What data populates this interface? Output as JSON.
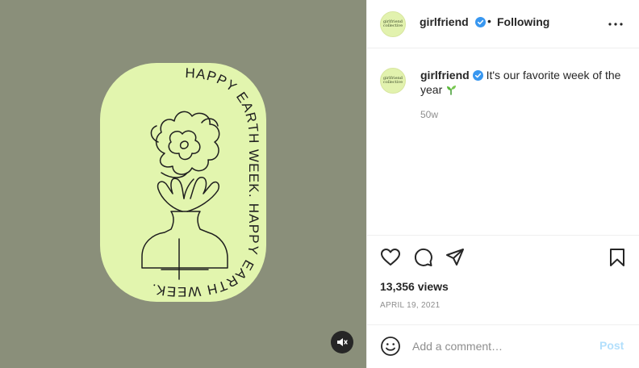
{
  "media": {
    "background": "#8a8f7a",
    "badge_color": "#e2f5ae",
    "ring_text_top": "HAPPY EARTH WEEK. HAPPY EARTH WEEK.",
    "ring_text_bottom": "HAPPY EARTH WEEK. HAPPY EARTH WEEK.",
    "mute_icon": "speaker-muted-icon"
  },
  "header": {
    "avatar_line1": "girlfriend",
    "avatar_line2": "collective",
    "username": "girlfriend",
    "verified_icon": "verified-badge-icon",
    "separator": "•",
    "follow_label": "Following",
    "more_icon": "more-horizontal-icon"
  },
  "caption": {
    "avatar_line1": "girlfriend",
    "avatar_line2": "collective",
    "username": "girlfriend",
    "text": "It's our favorite week of the year",
    "emoji_icon": "seedling-icon",
    "time_ago": "50w"
  },
  "actions": {
    "like_icon": "heart-icon",
    "comment_icon": "comment-bubble-icon",
    "share_icon": "paper-plane-icon",
    "save_icon": "bookmark-icon",
    "views": "13,356 views",
    "date": "APRIL 19, 2021"
  },
  "comment_box": {
    "emoji_icon": "smiley-icon",
    "placeholder": "Add a comment…",
    "post_label": "Post",
    "post_color": "#b2dffc"
  },
  "colors": {
    "verified": "#3897f0",
    "text_primary": "#262626",
    "text_secondary": "#8e8e8e",
    "divider": "#efefef"
  }
}
